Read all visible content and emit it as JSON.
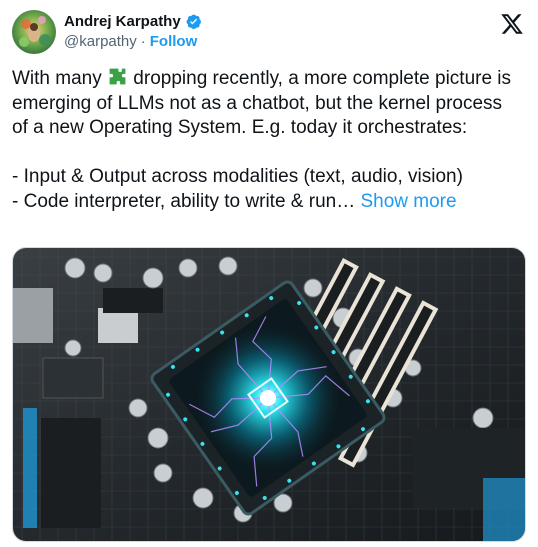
{
  "author": {
    "name": "Andrej Karpathy",
    "handle": "@karpathy",
    "separator": "·",
    "follow_label": "Follow",
    "verified": true
  },
  "tweet": {
    "lines": [
      "With many ",
      " dropping recently, a more complete picture is emerging of LLMs not as a chatbot, but the kernel process of a new Operating System. E.g. today it orchestrates:\n\n- Input & Output across modalities (text, audio, vision)\n- Code interpreter, ability to write & run… "
    ],
    "inline_emoji": "puzzle-piece",
    "show_more_label": "Show more"
  },
  "media": {
    "icon": "image",
    "description_colors": {
      "accent": "#18e0e6",
      "purple": "#b58cff",
      "board": "#2a2f33"
    }
  },
  "colors": {
    "link": "#1d9bf0",
    "text": "#0f1419",
    "muted": "#536471"
  }
}
